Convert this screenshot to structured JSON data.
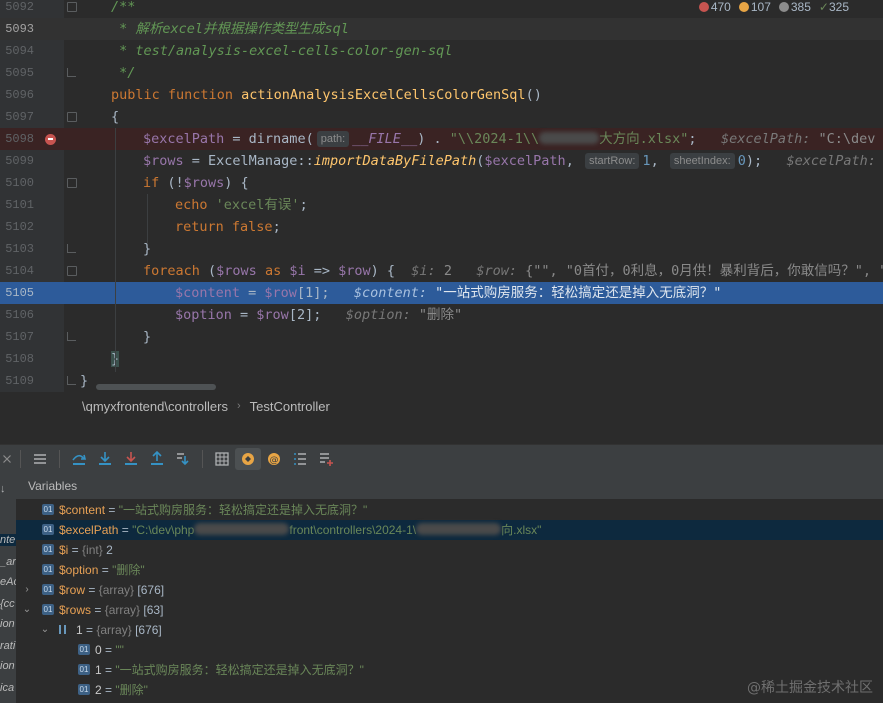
{
  "inspections": {
    "errors": "470",
    "warnings": "107",
    "weak_warnings": "385",
    "typos": "325"
  },
  "editor": {
    "lines": [
      {
        "num": "5092"
      },
      {
        "num": "5093"
      },
      {
        "num": "5094"
      },
      {
        "num": "5095"
      },
      {
        "num": "5096"
      },
      {
        "num": "5097"
      },
      {
        "num": "5098"
      },
      {
        "num": "5099"
      },
      {
        "num": "5100"
      },
      {
        "num": "5101"
      },
      {
        "num": "5102"
      },
      {
        "num": "5103"
      },
      {
        "num": "5104"
      },
      {
        "num": "5105"
      },
      {
        "num": "5106"
      },
      {
        "num": "5107"
      },
      {
        "num": "5108"
      },
      {
        "num": "5109"
      }
    ],
    "doc_open": "/**",
    "doc_line1": " * 解析excel并根据操作类型生成sql",
    "doc_line2": " * test/analysis-excel-cells-color-gen-sql",
    "doc_close": " */",
    "kw_public": "public",
    "kw_function": "function",
    "func_name": "actionAnalysisExcelCellsColorGenSql",
    "parens": "()",
    "brace_open": "{",
    "brace_close": "}",
    "l5098": {
      "var": "$excelPath",
      "eq": " = ",
      "call": "dirname(",
      "hint": "path:",
      "const": "__FILE__",
      "dot": ") . ",
      "str_a": "\"\\\\2024-1\\\\",
      "str_b": "大方向.xlsx\"",
      "semi": ";",
      "inline_name": "$excelPath:",
      "inline_val": "\"C:\\dev"
    },
    "l5099": {
      "var": "$rows",
      "eq": " = ",
      "cls": "ExcelManage::",
      "method": "importDataByFilePath",
      "open": "(",
      "arg": "$excelPath",
      "comma1": ", ",
      "hint1": "startRow:",
      "num1": "1",
      "comma2": ", ",
      "hint2": "sheetIndex:",
      "num2": "0",
      "close": ");",
      "inline_name": "$excelPath:"
    },
    "l5100": {
      "kw": "if",
      "rest1": " (!",
      "var": "$rows",
      "rest2": ") {"
    },
    "l5101": {
      "kw": "echo",
      "str": "'excel有误'",
      "semi": ";"
    },
    "l5102": {
      "kw": "return",
      "val": "false",
      "semi": ";"
    },
    "l5104": {
      "kw": "foreach",
      "p1": " (",
      "var1": "$rows",
      "as": " as ",
      "var2": "$i",
      "arrow": " => ",
      "var3": "$row",
      "p2": ") {",
      "inline1_name": "$i:",
      "inline1_val": "2",
      "inline2_name": "$row:",
      "inline2_val": "{\"\", \"0首付，0利息，0月供！暴利背后，你敢信吗？\", \""
    },
    "l5105": {
      "var": "$content",
      "eq": " = ",
      "var2": "$row",
      "idx": "[1];",
      "inline_name": "$content:",
      "inline_val": "\"一站式购房服务：轻松搞定还是掉入无底洞？\""
    },
    "l5106": {
      "var": "$option",
      "eq": " = ",
      "var2": "$row",
      "idx": "[2];",
      "inline_name": "$option:",
      "inline_val": "\"删除\""
    }
  },
  "breadcrumb": {
    "path": "\\qmyxfrontend\\controllers",
    "sep": "›",
    "class": "TestController"
  },
  "variables": {
    "title": "Variables",
    "rows": [
      {
        "name": "$content",
        "eq": " = ",
        "value": "\"一站式购房服务：轻松搞定还是掉入无底洞？\""
      },
      {
        "name": "$excelPath",
        "eq": " = ",
        "value_a": "\"C:\\dev\\php",
        "value_b": "front",
        "value_c": "\\controllers\\2024-1\\",
        "value_d": "向.xlsx\""
      },
      {
        "name": "$i",
        "eq": " = ",
        "type": "{int}",
        "value": "2"
      },
      {
        "name": "$option",
        "eq": " = ",
        "value": "\"删除\""
      },
      {
        "name": "$row",
        "eq": " = ",
        "type": "{array}",
        "value": "[676]"
      },
      {
        "name": "$rows",
        "eq": " = ",
        "type": "{array}",
        "value": "[63]"
      },
      {
        "name": "1",
        "eq": " = ",
        "type": "{array}",
        "value": "[676]"
      },
      {
        "name": "0",
        "eq": " = ",
        "value": "\"\""
      },
      {
        "name": "1",
        "eq": " = ",
        "value": "\"一站式购房服务：轻松搞定还是掉入无底洞？\""
      },
      {
        "name": "2",
        "eq": " = ",
        "value": "\"删除\""
      }
    ],
    "badge": "01"
  },
  "left_strip": [
    "nte",
    "_ar",
    "eAc",
    "{cc",
    "ion",
    "rati",
    "ion",
    "ica"
  ],
  "watermark": "@稀土掘金技术社区",
  "colors": {
    "keyword": "#cc7832",
    "function": "#ffc66d",
    "variable": "#9876aa",
    "string": "#6a8759",
    "number": "#6897bb",
    "doc": "#629755",
    "exec_line": "#2d5b9a",
    "breakpoint": "#c75450"
  }
}
